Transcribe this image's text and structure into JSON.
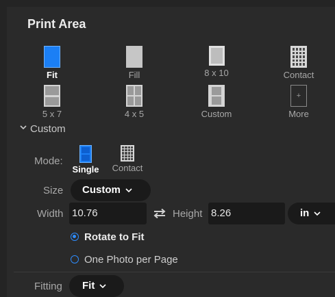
{
  "panel": {
    "title": "Print Area"
  },
  "presets": [
    {
      "id": "fit",
      "label": "Fit",
      "icon": "fit-layout-icon",
      "selected": true
    },
    {
      "id": "fill",
      "label": "Fill",
      "icon": "fill-layout-icon",
      "selected": false
    },
    {
      "id": "8x10",
      "label": "8 x 10",
      "icon": "8x10-layout-icon",
      "selected": false
    },
    {
      "id": "contact",
      "label": "Contact",
      "icon": "contact-sheet-icon",
      "selected": false
    },
    {
      "id": "5x7",
      "label": "5 x 7",
      "icon": "5x7-layout-icon",
      "selected": false
    },
    {
      "id": "4x5",
      "label": "4 x 5",
      "icon": "4x5-layout-icon",
      "selected": false
    },
    {
      "id": "custom",
      "label": "Custom",
      "icon": "custom-layout-icon",
      "selected": false
    },
    {
      "id": "more",
      "label": "More",
      "icon": "more-plus-icon",
      "selected": false
    }
  ],
  "custom_section": {
    "header": "Custom",
    "expanded": true,
    "mode": {
      "label": "Mode:",
      "options": [
        {
          "label": "Single",
          "icon": "single-mode-icon",
          "selected": true
        },
        {
          "label": "Contact",
          "icon": "contact-mode-icon",
          "selected": false
        }
      ]
    },
    "size": {
      "label": "Size",
      "value": "Custom"
    },
    "width": {
      "label": "Width",
      "value": "10.76"
    },
    "swap_icon": "swap-arrows-icon",
    "height": {
      "label": "Height",
      "value": "8.26"
    },
    "unit": {
      "value": "in"
    },
    "rotate_to_fit": {
      "label": "Rotate to Fit",
      "selected": true
    },
    "one_photo_per_page": {
      "label": "One Photo per Page",
      "selected": false
    },
    "fitting": {
      "label": "Fitting",
      "value": "Fit"
    }
  },
  "colors": {
    "accent": "#1b7ff5",
    "radio": "#2e8dff",
    "panel_bg": "#2a2a2a",
    "control_bg": "#1a1a1a"
  }
}
